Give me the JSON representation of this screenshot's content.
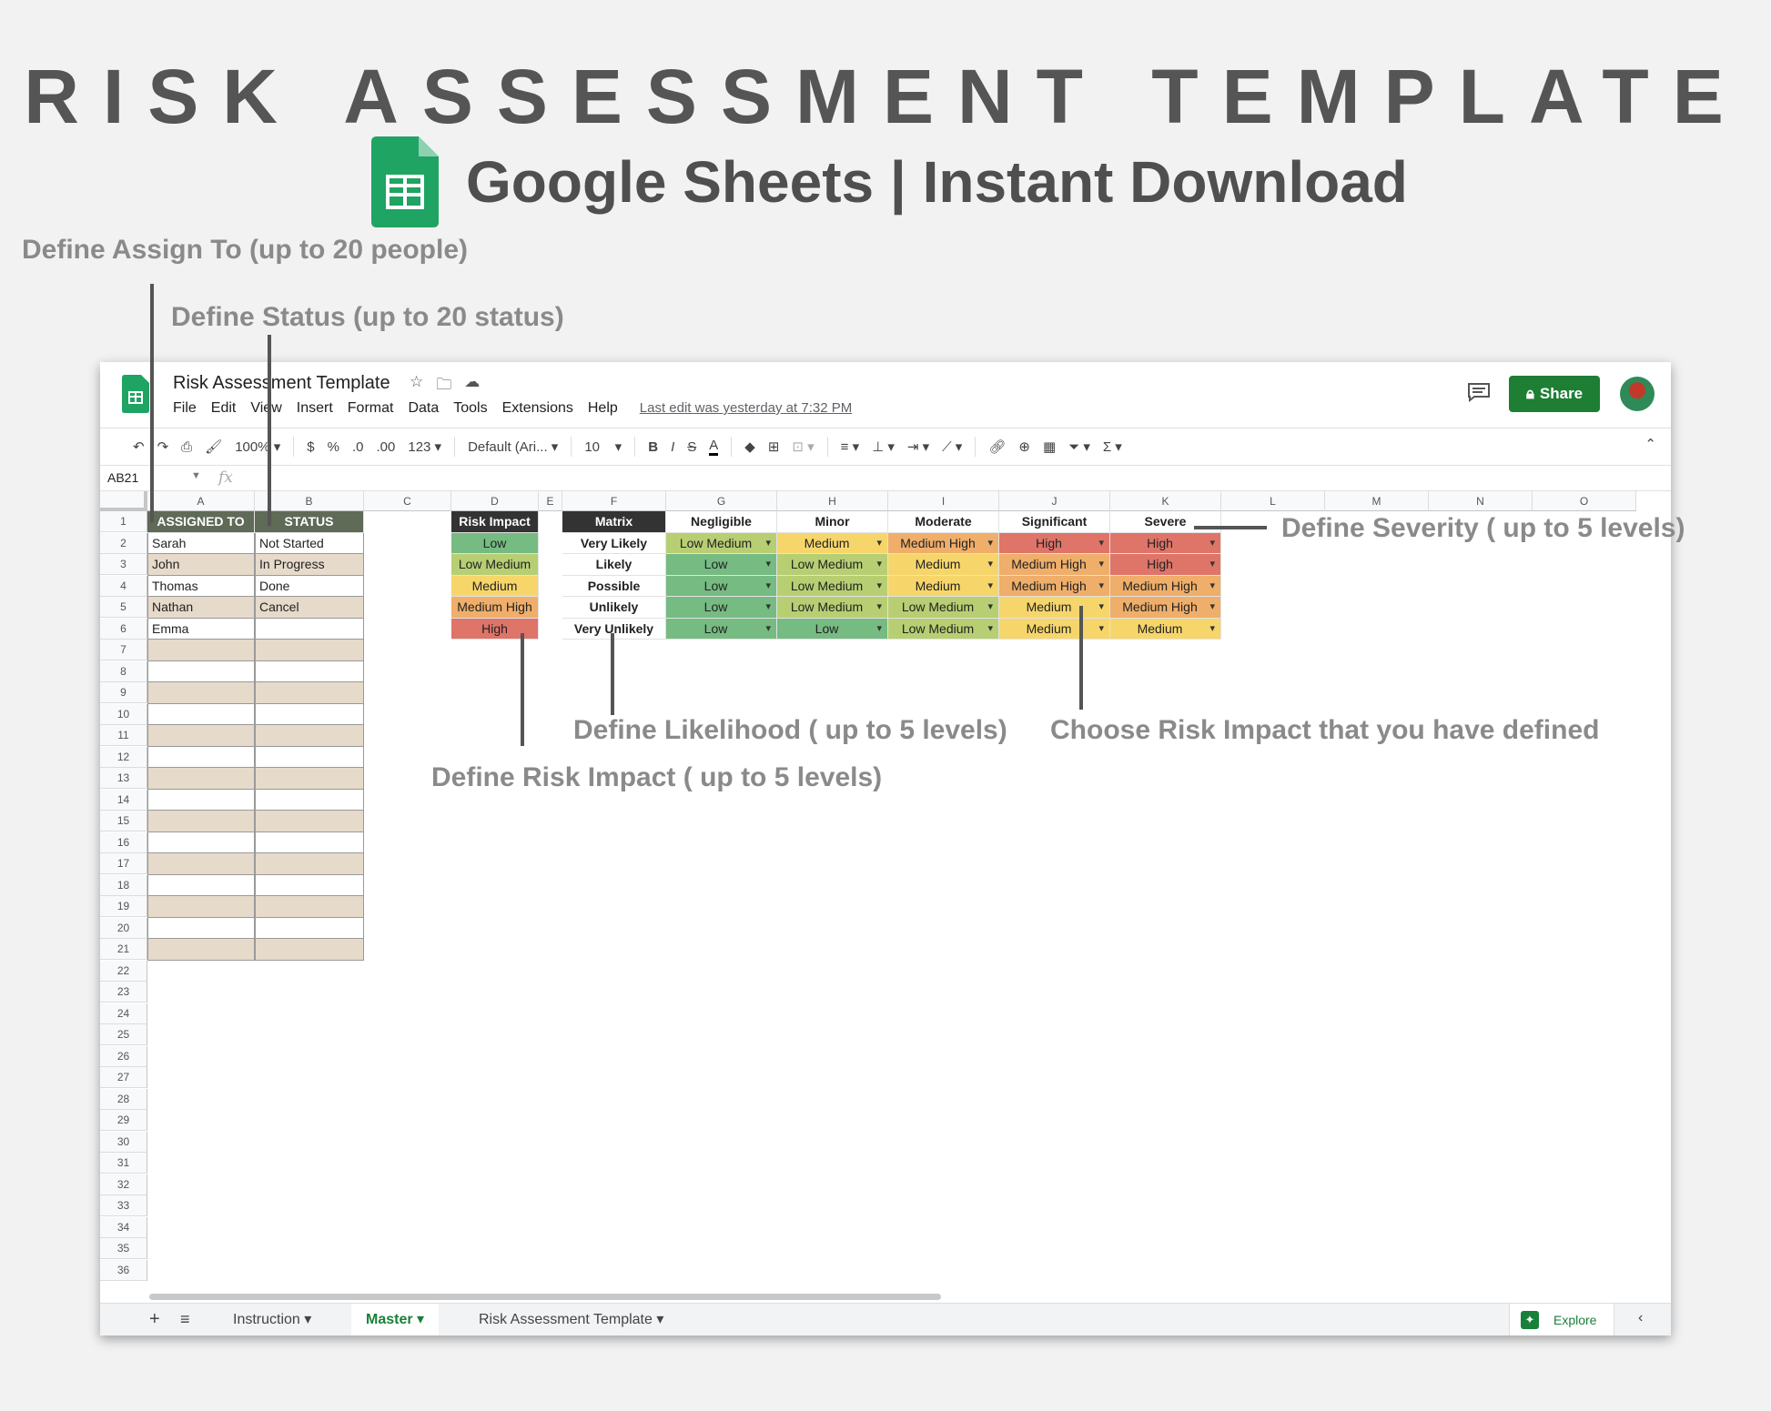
{
  "hero": {
    "title": "RISK ASSESSMENT TEMPLATE",
    "subtitle": "Google Sheets | Instant Download"
  },
  "annotations": {
    "assign_to": "Define Assign To (up to 20 people)",
    "status": "Define Status (up to 20 status)",
    "severity": "Define Severity ( up to 5 levels)",
    "likelihood": "Define Likelihood ( up to 5 levels)",
    "choose_impact": "Choose Risk Impact that you have defined",
    "risk_impact": "Define Risk Impact ( up to 5 levels)"
  },
  "window": {
    "doc_title": "Risk Assessment Template",
    "menu": [
      "File",
      "Edit",
      "View",
      "Insert",
      "Format",
      "Data",
      "Tools",
      "Extensions",
      "Help"
    ],
    "last_edit": "Last edit was yesterday at 7:32 PM",
    "share_label": "Share"
  },
  "toolbar": {
    "zoom": "100%",
    "currency": "$",
    "percent": "%",
    "dec_decrease": ".0",
    "dec_increase": ".00",
    "more_formats": "123",
    "font": "Default (Ari...",
    "font_size": "10"
  },
  "formula_bar": {
    "cell_ref": "AB21",
    "fx": "fx"
  },
  "grid": {
    "columns": [
      "A",
      "B",
      "C",
      "D",
      "E",
      "F",
      "G",
      "H",
      "I",
      "J",
      "K",
      "L",
      "M",
      "N",
      "O"
    ],
    "rows": [
      "1",
      "2",
      "3",
      "4",
      "5",
      "6",
      "7",
      "8",
      "9",
      "10",
      "11",
      "12",
      "13",
      "14",
      "15",
      "16",
      "17",
      "18",
      "19",
      "20",
      "21",
      "22",
      "23",
      "24",
      "25",
      "26",
      "27",
      "28",
      "29",
      "30",
      "31",
      "32",
      "33",
      "34",
      "35",
      "36"
    ]
  },
  "assign_table": {
    "header_a": "ASSIGNED TO",
    "header_b": "STATUS",
    "people": [
      "Sarah",
      "John",
      "Thomas",
      "Nathan",
      "Emma"
    ],
    "statuses": [
      "Not Started",
      "In Progress",
      "Done",
      "Cancel"
    ]
  },
  "risk_impact": {
    "header": "Risk Impact",
    "levels": [
      "Low",
      "Low Medium",
      "Medium",
      "Medium High",
      "High"
    ]
  },
  "matrix": {
    "corner": "Matrix",
    "severity": [
      "Negligible",
      "Minor",
      "Moderate",
      "Significant",
      "Severe"
    ],
    "likelihood": [
      "Very Likely",
      "Likely",
      "Possible",
      "Unlikely",
      "Very Unlikely"
    ],
    "values": [
      [
        "Low Medium",
        "Medium",
        "Medium High",
        "High",
        "High"
      ],
      [
        "Low",
        "Low Medium",
        "Medium",
        "Medium High",
        "High"
      ],
      [
        "Low",
        "Low Medium",
        "Medium",
        "Medium High",
        "Medium High"
      ],
      [
        "Low",
        "Low Medium",
        "Low Medium",
        "Medium",
        "Medium High"
      ],
      [
        "Low",
        "Low",
        "Low Medium",
        "Medium",
        "Medium"
      ]
    ]
  },
  "level_colors": {
    "Low": "#76bb82",
    "Low Medium": "#b7cf72",
    "Medium": "#f6d66b",
    "Medium High": "#efae6a",
    "High": "#df7469"
  },
  "tabs": {
    "items": [
      "Instruction",
      "Master",
      "Risk Assessment Template"
    ],
    "active": "Master",
    "explore": "Explore"
  }
}
